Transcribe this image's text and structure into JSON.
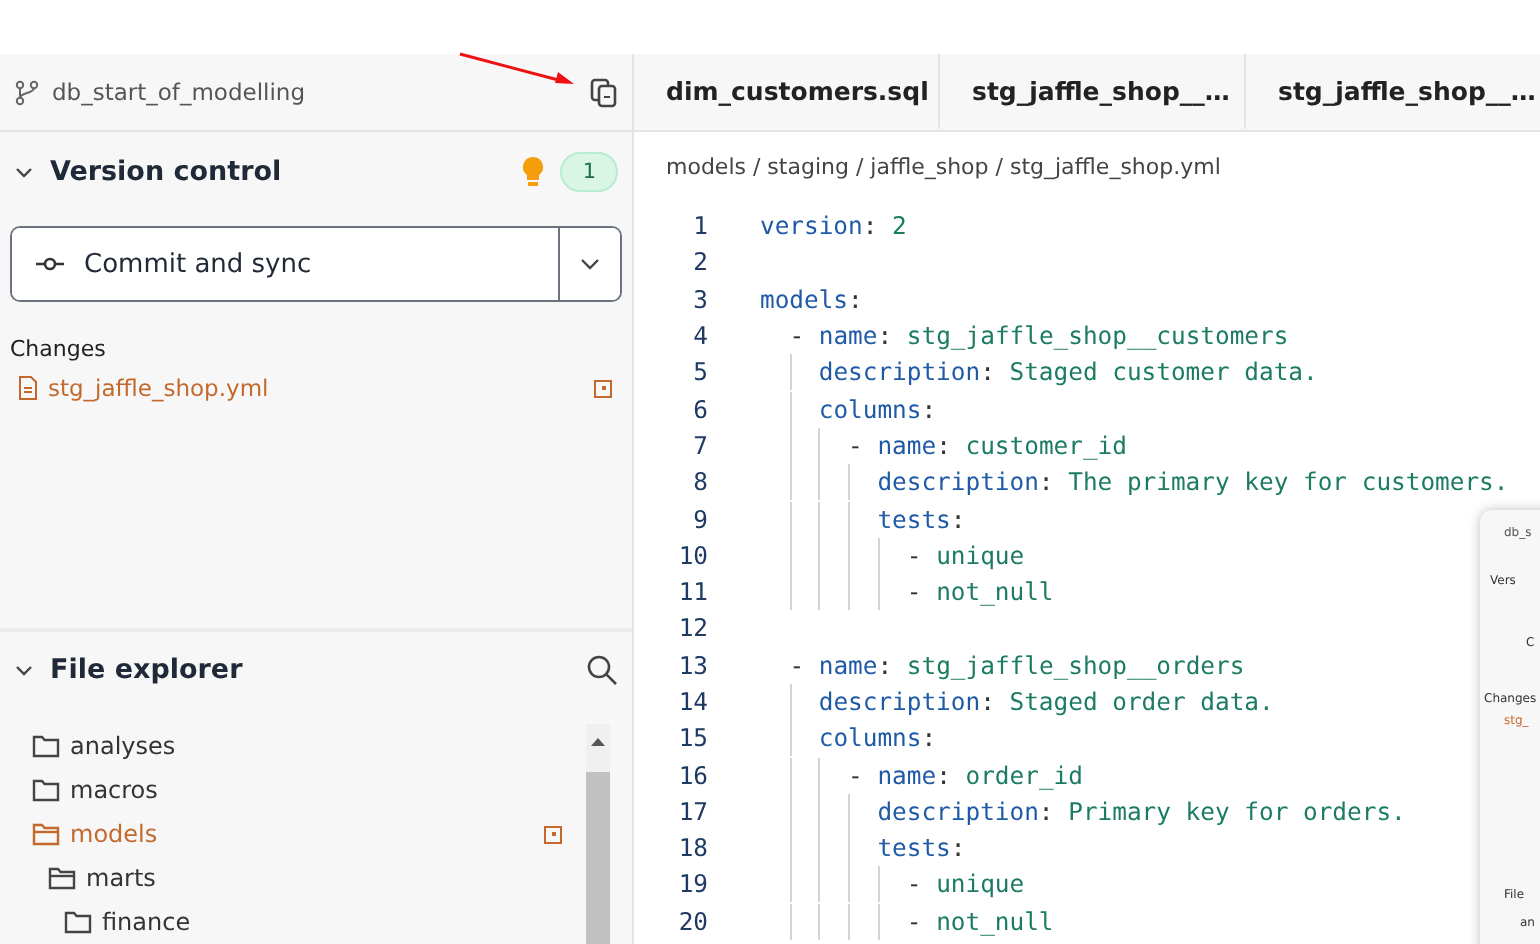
{
  "sidebar": {
    "branch": "db_start_of_modelling",
    "version_control": {
      "title": "Version control",
      "expanded": true,
      "badge": "1",
      "action": "Commit and sync",
      "changes_label": "Changes",
      "changes": [
        {
          "name": "stg_jaffle_shop.yml"
        }
      ]
    },
    "file_explorer": {
      "title": "File explorer",
      "expanded": true,
      "items": [
        {
          "name": "analyses",
          "modified": false,
          "expanded": false
        },
        {
          "name": "macros",
          "modified": false,
          "expanded": false
        },
        {
          "name": "models",
          "modified": true,
          "expanded": true,
          "children": [
            {
              "name": "marts",
              "modified": false,
              "expanded": true,
              "children": [
                {
                  "name": "finance",
                  "modified": false,
                  "expanded": false
                }
              ]
            }
          ]
        }
      ]
    }
  },
  "tabs": [
    {
      "label": "dim_customers.sql",
      "selected": false
    },
    {
      "label": "stg_jaffle_shop__…",
      "selected": false
    },
    {
      "label": "stg_jaffle_shop__…",
      "selected": false
    }
  ],
  "breadcrumb": "models / staging / jaffle_shop / stg_jaffle_shop.yml",
  "code": [
    {
      "number": "1",
      "text": "version: 2"
    },
    {
      "number": "2"
    },
    {
      "number": "3",
      "text": "models:"
    },
    {
      "number": "4",
      "text": "  - name: stg_jaffle_shop__customers"
    },
    {
      "number": "5",
      "text": "    description: Staged customer data."
    },
    {
      "number": "6",
      "text": "    columns:"
    },
    {
      "number": "7",
      "text": "      - name: customer_id"
    },
    {
      "number": "8",
      "text": "        description: The primary key for customers."
    },
    {
      "number": "9",
      "text": "        tests:"
    },
    {
      "number": "10",
      "text": "          - unique"
    },
    {
      "number": "11",
      "text": "          - not_null"
    },
    {
      "number": "12"
    },
    {
      "number": "13",
      "text": "  - name: stg_jaffle_shop__orders"
    },
    {
      "number": "14",
      "text": "    description: Staged order data."
    },
    {
      "number": "15",
      "text": "    columns:"
    },
    {
      "number": "16",
      "text": "      - name: order_id"
    },
    {
      "number": "17",
      "text": "        description: Primary key for orders."
    },
    {
      "number": "18",
      "text": "        tests:"
    },
    {
      "number": "19",
      "text": "          - unique"
    },
    {
      "number": "20",
      "text": "          - not_null"
    }
  ],
  "inset": {
    "kind": "picture",
    "texts": [
      "db_s",
      "Vers",
      "C",
      "Changes",
      "stg_",
      "File",
      "an"
    ]
  }
}
